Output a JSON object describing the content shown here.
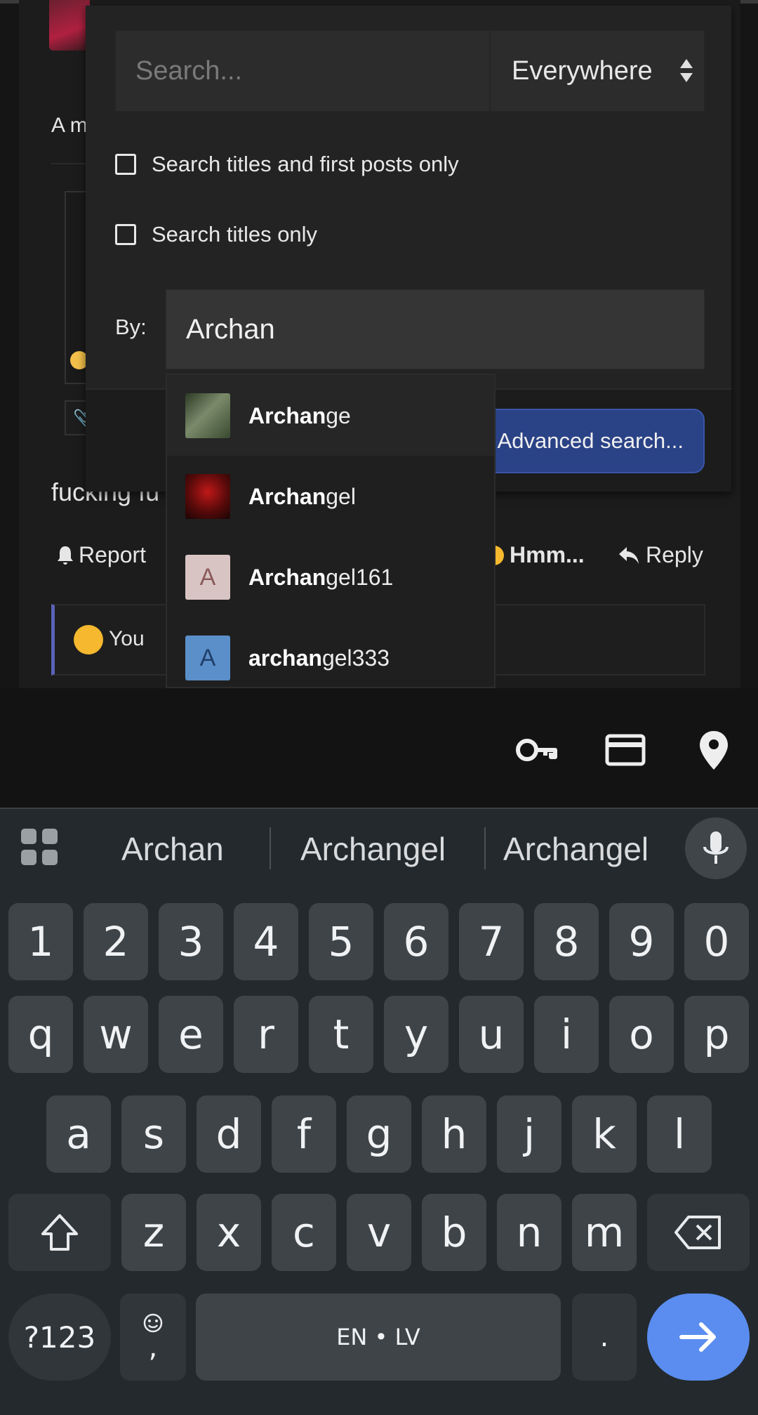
{
  "background_post": {
    "text_fragment_1": "A m",
    "text_fragment_2": "fucking fu",
    "report_label": "Report",
    "hmm_label": "Hmm...",
    "reply_label": "Reply",
    "reaction_you": "You"
  },
  "search": {
    "placeholder": "Search...",
    "scope_value": "Everywhere",
    "option_titles_first_posts": "Search titles and first posts only",
    "option_titles_only": "Search titles only",
    "by_label": "By:",
    "by_value": "Archan",
    "advanced_button": "Advanced search..."
  },
  "autocomplete": {
    "query_match": "Archan",
    "items": [
      {
        "match": "Archan",
        "rest": "ge",
        "avatar_letter": "",
        "avatar_color": "#4a5a3a"
      },
      {
        "match": "Archan",
        "rest": "gel",
        "avatar_letter": "",
        "avatar_color": "#5a0a0a"
      },
      {
        "match": "Archan",
        "rest": "gel161",
        "avatar_letter": "A",
        "avatar_color": "#d9c4c4"
      },
      {
        "match": "archan",
        "rest": "gel333",
        "avatar_letter": "A",
        "avatar_color": "#5b8fc9"
      }
    ]
  },
  "autofill": {
    "icons": [
      "key-icon",
      "credit-card-icon",
      "location-pin-icon"
    ]
  },
  "keyboard": {
    "suggestions": [
      "Archan",
      "Archangel",
      "Archangel"
    ],
    "row_numbers": [
      "1",
      "2",
      "3",
      "4",
      "5",
      "6",
      "7",
      "8",
      "9",
      "0"
    ],
    "row_1": [
      "q",
      "w",
      "e",
      "r",
      "t",
      "y",
      "u",
      "i",
      "o",
      "p"
    ],
    "row_2": [
      "a",
      "s",
      "d",
      "f",
      "g",
      "h",
      "j",
      "k",
      "l"
    ],
    "row_3": [
      "z",
      "x",
      "c",
      "v",
      "b",
      "n",
      "m"
    ],
    "symbols_key": "?123",
    "comma_key": ",",
    "space_label": "EN • LV",
    "period_key": ".",
    "colors": {
      "background": "#23292d",
      "key": "#3e4448",
      "action": "#5a8def"
    }
  }
}
